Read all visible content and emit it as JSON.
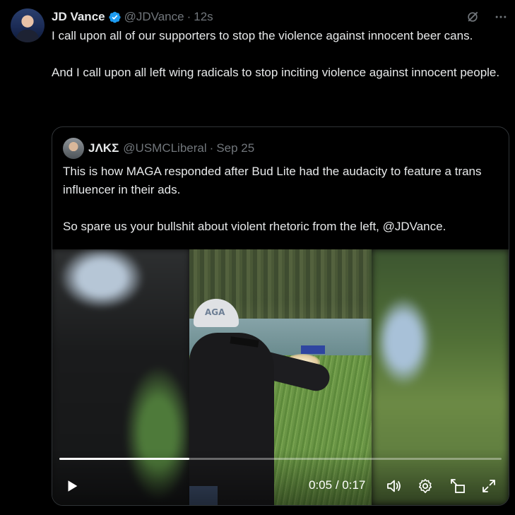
{
  "tweet": {
    "author_name": "JD Vance",
    "handle": "@JDVance",
    "separator": "·",
    "time": "12s",
    "text_paragraphs": [
      "I call upon all of our supporters to stop the violence against innocent beer cans.",
      "And I call upon all left wing radicals to stop inciting violence against innocent people."
    ],
    "icons": [
      "verified-badge-icon",
      "grok-icon",
      "more-icon"
    ]
  },
  "quote": {
    "author_name": "JΛKΣ",
    "handle": "@USMCLiberal",
    "separator": "·",
    "date": "Sep 25",
    "text_paragraphs": [
      "This is how MAGA responded after Bud Lite had the audacity to feature a trans influencer in their ads.",
      "So spare us your bullshit about violent rhetoric from the left, @JDVance."
    ],
    "video": {
      "cap_text": "AGA",
      "current_time": "0:05",
      "time_separator": " / ",
      "duration": "0:17",
      "progress_fraction": 0.294,
      "icons": [
        "play-icon",
        "volume-icon",
        "settings-icon",
        "pip-icon",
        "fullscreen-icon"
      ]
    }
  },
  "colors": {
    "background": "#000000",
    "text": "#e7e9ea",
    "muted": "#71767b",
    "verified": "#1d9bf0",
    "border": "#2f3336"
  }
}
